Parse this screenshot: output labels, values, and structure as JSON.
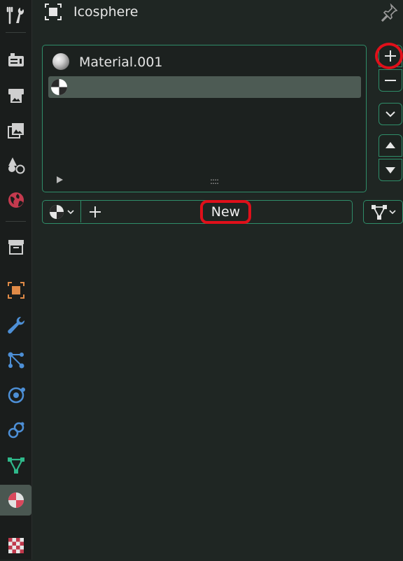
{
  "header": {
    "object_name": "Icosphere"
  },
  "material_slots": {
    "items": [
      {
        "label": "Material.001",
        "selected": false
      },
      {
        "label": "",
        "selected": true
      }
    ]
  },
  "material_bar": {
    "new_label": "New"
  },
  "sidebar": {
    "tabs": [
      "tool-icon",
      "render-icon",
      "output-icon",
      "view-layer-icon",
      "scene-icon",
      "world-icon",
      "collection-icon",
      "object-icon",
      "modifier-icon",
      "particles-icon",
      "physics-icon",
      "constraints-icon",
      "data-icon",
      "material-icon",
      "texture-icon"
    ],
    "active": "material-icon"
  },
  "colors": {
    "accent_outline": "#2f8d69",
    "highlight": "#e0101a",
    "selected_row": "#4d5b54"
  }
}
